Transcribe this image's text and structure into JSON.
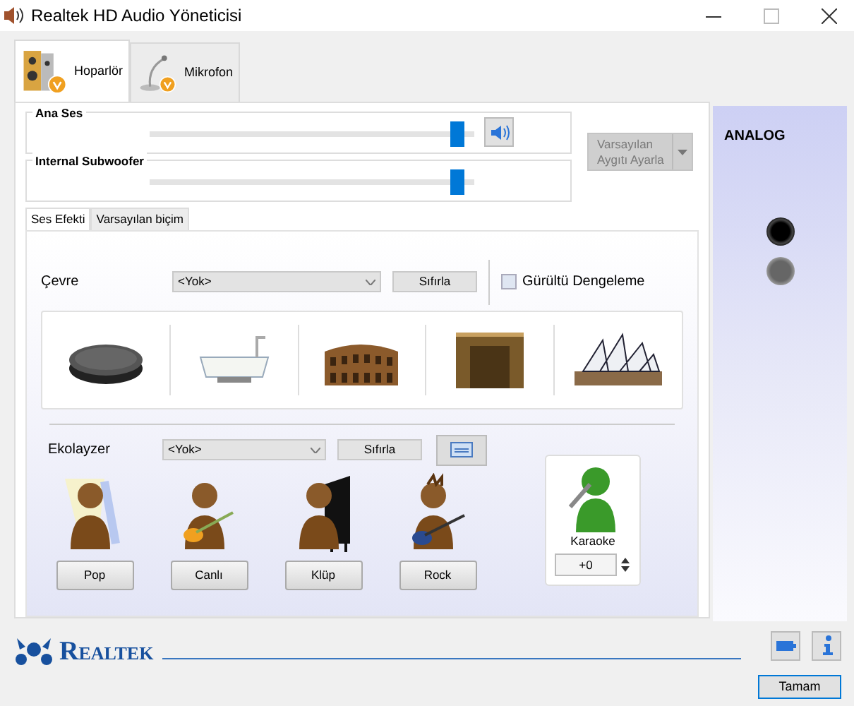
{
  "window": {
    "title": "Realtek HD Audio Yöneticisi"
  },
  "device_tabs": [
    {
      "label": "Hoparlör",
      "selected": true,
      "kind": "speaker"
    },
    {
      "label": "Mikrofon",
      "selected": false,
      "kind": "microphone"
    }
  ],
  "volume_groups": [
    {
      "label": "Ana Ses",
      "level": 0.97,
      "mute_button": true
    },
    {
      "label": "Internal Subwoofer",
      "level": 0.97,
      "mute_button": false
    }
  ],
  "default_device_button": {
    "lines": [
      "Varsayılan",
      "Aygıtı Ayarla"
    ],
    "disabled": true
  },
  "effect_tabs": [
    {
      "label": "Ses Efekti",
      "selected": true
    },
    {
      "label": "Varsayılan biçim",
      "selected": false
    }
  ],
  "environment": {
    "label": "Çevre",
    "value": "<Yok>",
    "reset": "Sıfırla",
    "noise_checkbox": {
      "label": "Gürültü Dengeleme",
      "checked": false
    }
  },
  "equalizer": {
    "label": "Ekolayzer",
    "value": "<Yok>",
    "reset": "Sıfırla",
    "presets": [
      {
        "label": "Pop",
        "kind": "singer"
      },
      {
        "label": "Canlı",
        "kind": "guitar"
      },
      {
        "label": "Klüp",
        "kind": "piano"
      },
      {
        "label": "Rock",
        "kind": "rock"
      }
    ]
  },
  "karaoke": {
    "label": "Karaoke",
    "value": "+0"
  },
  "analog_panel": {
    "title": "ANALOG",
    "jacks": [
      {
        "plugged": true
      },
      {
        "plugged": false
      }
    ]
  },
  "brand": "Realtek",
  "ok_button": "Tamam"
}
